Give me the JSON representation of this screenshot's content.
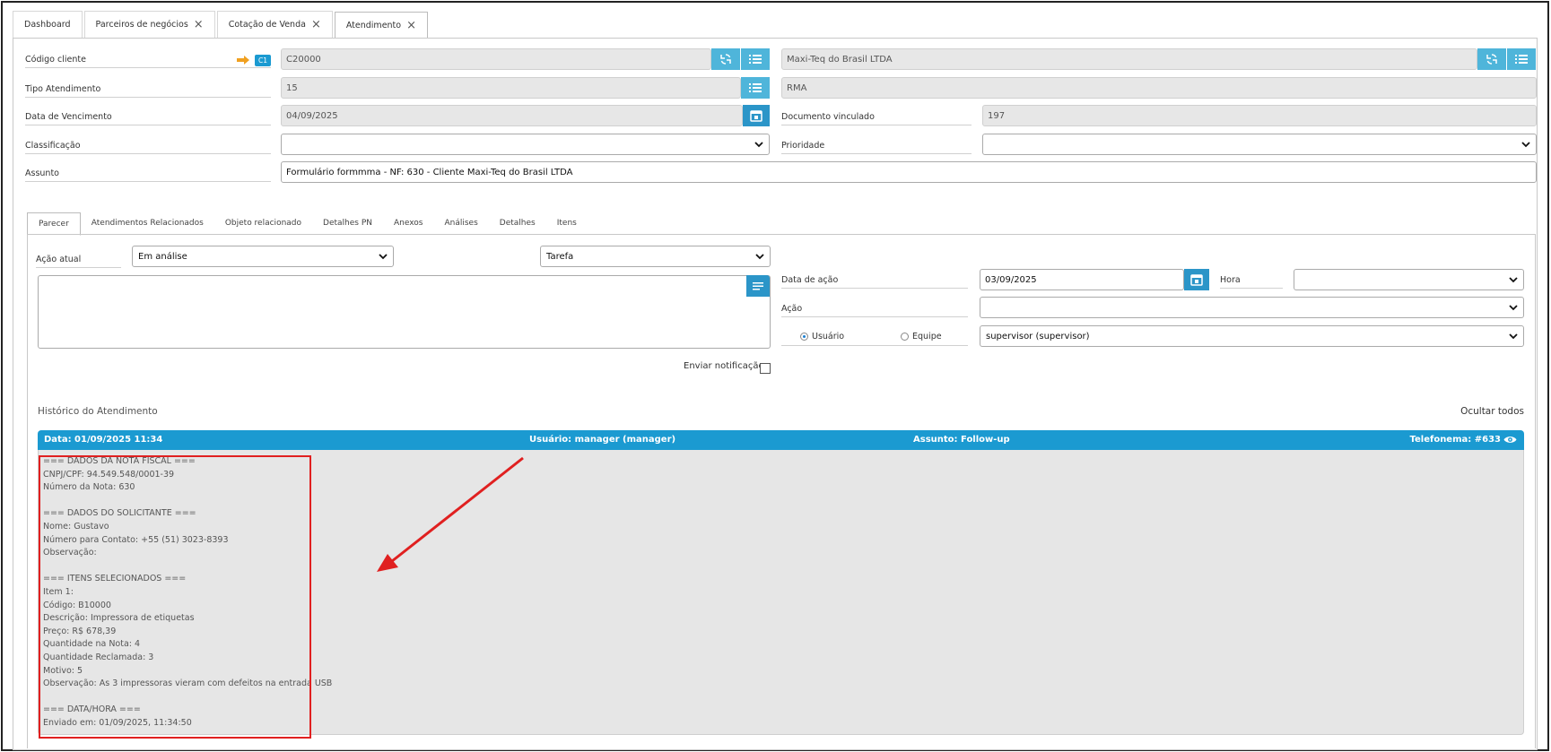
{
  "tabs": [
    {
      "label": "Dashboard",
      "closable": false
    },
    {
      "label": "Parceiros de negócios",
      "closable": true
    },
    {
      "label": "Cotação de Venda",
      "closable": true
    },
    {
      "label": "Atendimento",
      "closable": true,
      "active": true
    }
  ],
  "form": {
    "codigo_cliente_label": "Código cliente",
    "codigo_cliente_badge": "C1",
    "codigo_cliente_value": "C20000",
    "cliente_nome_value": "Maxi-Teq do Brasil LTDA",
    "tipo_atendimento_label": "Tipo Atendimento",
    "tipo_atendimento_value": "15",
    "tipo_atendimento_desc": "RMA",
    "data_vencimento_label": "Data de Vencimento",
    "data_vencimento_value": "04/09/2025",
    "documento_vinculado_label": "Documento vinculado",
    "documento_vinculado_value": "197",
    "classificacao_label": "Classificação",
    "classificacao_value": "",
    "prioridade_label": "Prioridade",
    "prioridade_value": "",
    "assunto_label": "Assunto",
    "assunto_value": "Formulário formmma - NF: 630 - Cliente Maxi-Teq do Brasil LTDA"
  },
  "subtabs": [
    "Parecer",
    "Atendimentos Relacionados",
    "Objeto relacionado",
    "Detalhes PN",
    "Anexos",
    "Análises",
    "Detalhes",
    "Itens"
  ],
  "parecer": {
    "acao_atual_label": "Ação atual",
    "acao_atual_value": "Em análise",
    "tipo_value": "Tarefa",
    "data_acao_label": "Data de ação",
    "data_acao_value": "03/09/2025",
    "hora_label": "Hora",
    "hora_value": "",
    "acao_label": "Ação",
    "acao_value": "",
    "radio_usuario": "Usuário",
    "radio_equipe": "Equipe",
    "responsavel_value": "supervisor (supervisor)",
    "enviar_notificacao": "Enviar notificação"
  },
  "historico": {
    "title": "Histórico do Atendimento",
    "ocultar_todos": "Ocultar todos",
    "entry": {
      "data": "Data: 01/09/2025 11:34",
      "usuario": "Usuário: manager (manager)",
      "assunto": "Assunto: Follow-up",
      "telefonema": "Telefonema: #633",
      "lines": [
        "=== DADOS DA NOTA FISCAL ===",
        "CNPJ/CPF: 94.549.548/0001-39",
        "Número da Nota: 630",
        "",
        "=== DADOS DO SOLICITANTE ===",
        "Nome: Gustavo",
        "Número para Contato: +55 (51) 3023-8393",
        "Observação:",
        "",
        "=== ITENS SELECIONADOS ===",
        "Item 1:",
        "Código: B10000",
        "Descrição: Impressora de etiquetas",
        "Preço: R$ 678,39",
        "Quantidade na Nota: 4",
        "Quantidade Reclamada: 3",
        "Motivo: 5",
        "Observação: As 3 impressoras vieram com defeitos na entrada USB",
        "",
        "=== DATA/HORA ===",
        "Enviado em: 01/09/2025, 11:34:50"
      ]
    }
  },
  "colors": {
    "accent": "#1b9ad1",
    "button": "#4fb5da",
    "annotation": "#e02020",
    "arrow_orange": "#f0a020"
  }
}
